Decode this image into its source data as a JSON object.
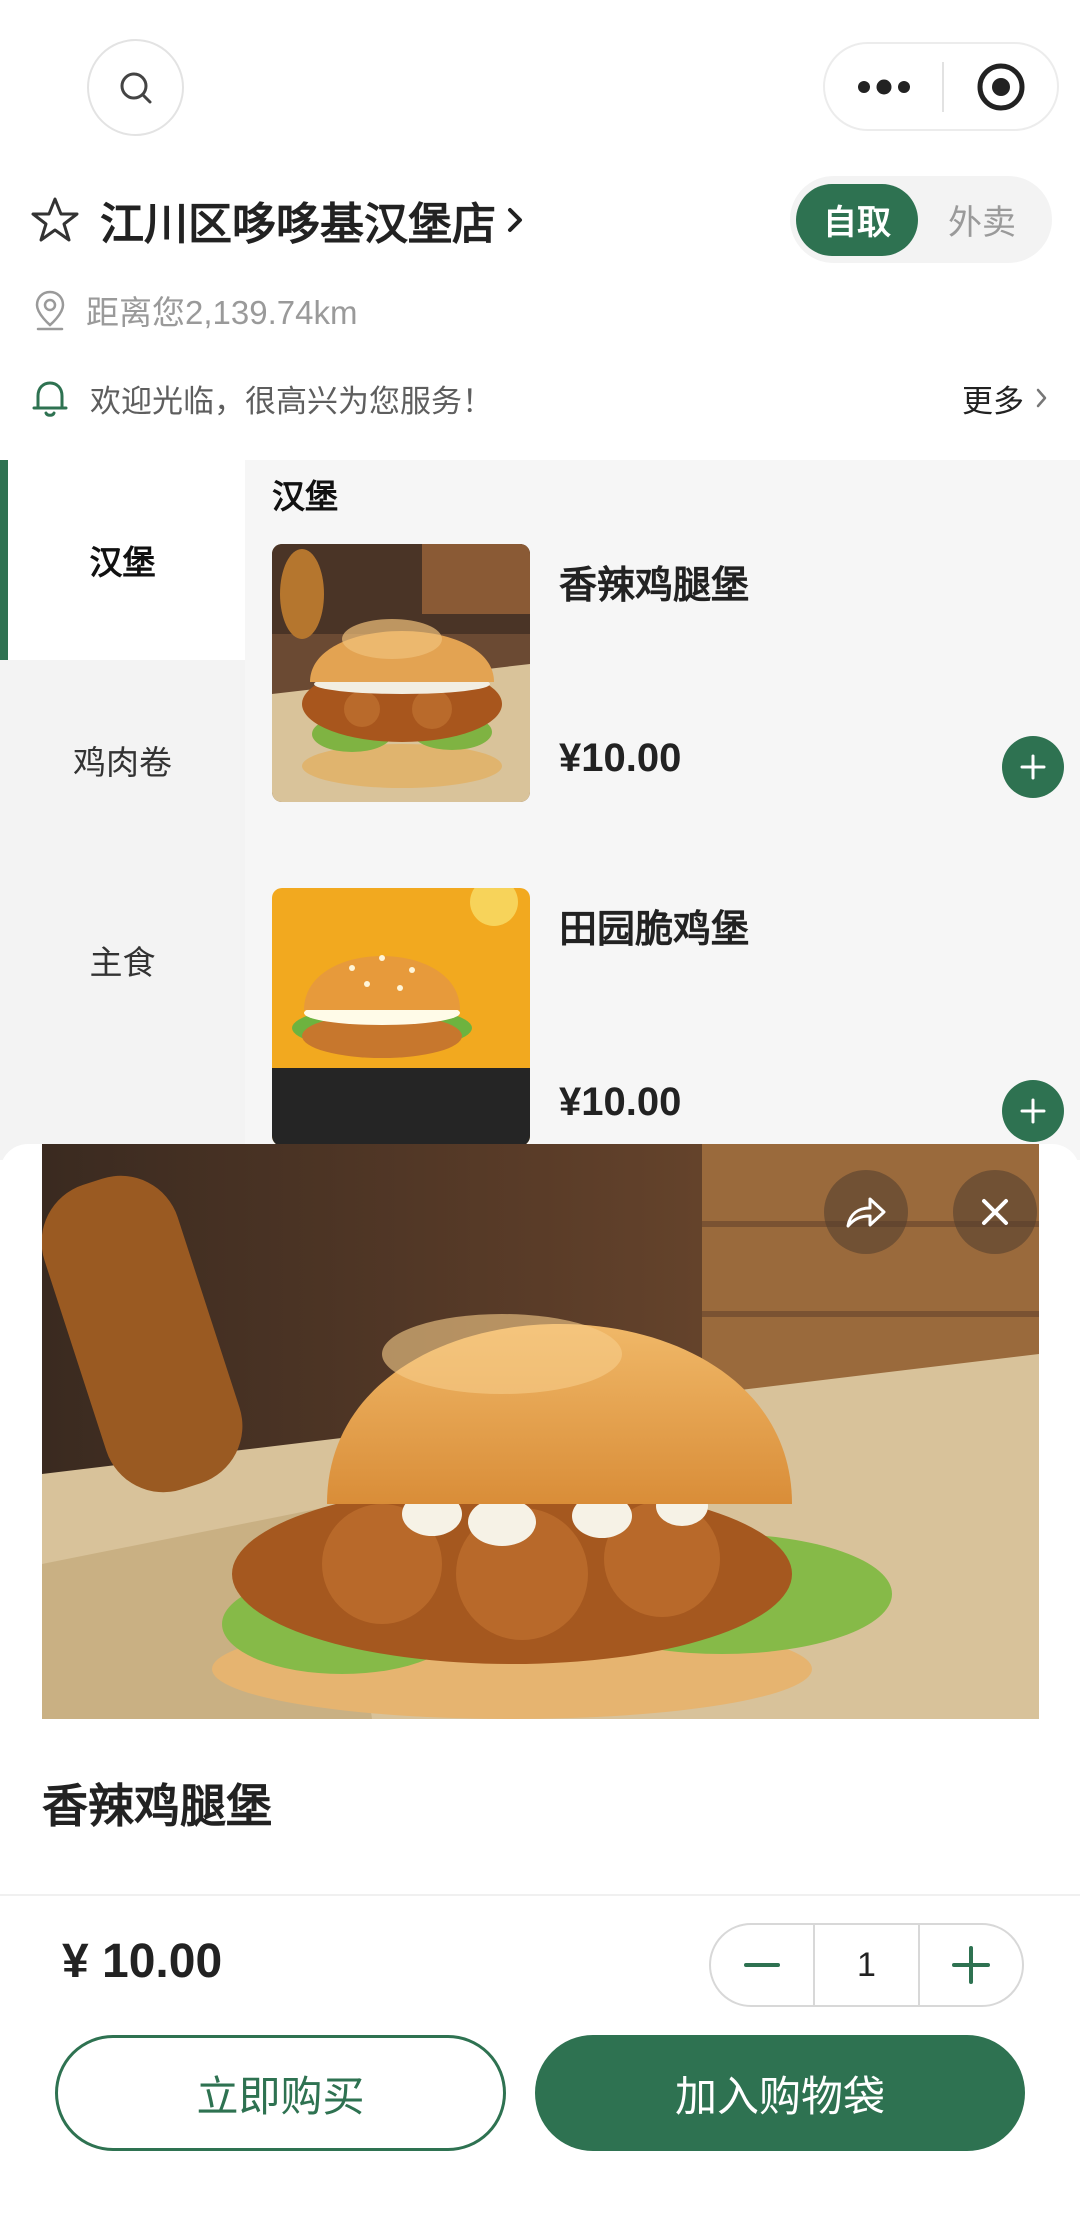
{
  "store": {
    "name": "江川区哆哆基汉堡店",
    "distance": "距离您2,139.74km",
    "notice": "欢迎光临，很高兴为您服务！",
    "more": "更多"
  },
  "mode": {
    "pickup": "自取",
    "delivery": "外卖",
    "selected": "自取"
  },
  "categories": [
    {
      "label": "汉堡",
      "active": true
    },
    {
      "label": "鸡肉卷",
      "active": false
    },
    {
      "label": "主食",
      "active": false
    }
  ],
  "section_title": "汉堡",
  "products": [
    {
      "name": "香辣鸡腿堡",
      "price": "¥10.00"
    },
    {
      "name": "田园脆鸡堡",
      "price": "¥10.00"
    }
  ],
  "detail": {
    "name": "香辣鸡腿堡",
    "price": "¥ 10.00",
    "quantity": "1",
    "buy_now": "立即购买",
    "add_to_bag": "加入购物袋"
  },
  "colors": {
    "accent": "#2e7251",
    "muted": "#9a9a9a"
  },
  "icons": [
    "search-icon",
    "more-dots-icon",
    "target-icon",
    "star-icon",
    "chevron-right-icon",
    "location-pin-icon",
    "bell-icon",
    "plus-icon",
    "minus-icon",
    "share-icon",
    "close-icon"
  ]
}
